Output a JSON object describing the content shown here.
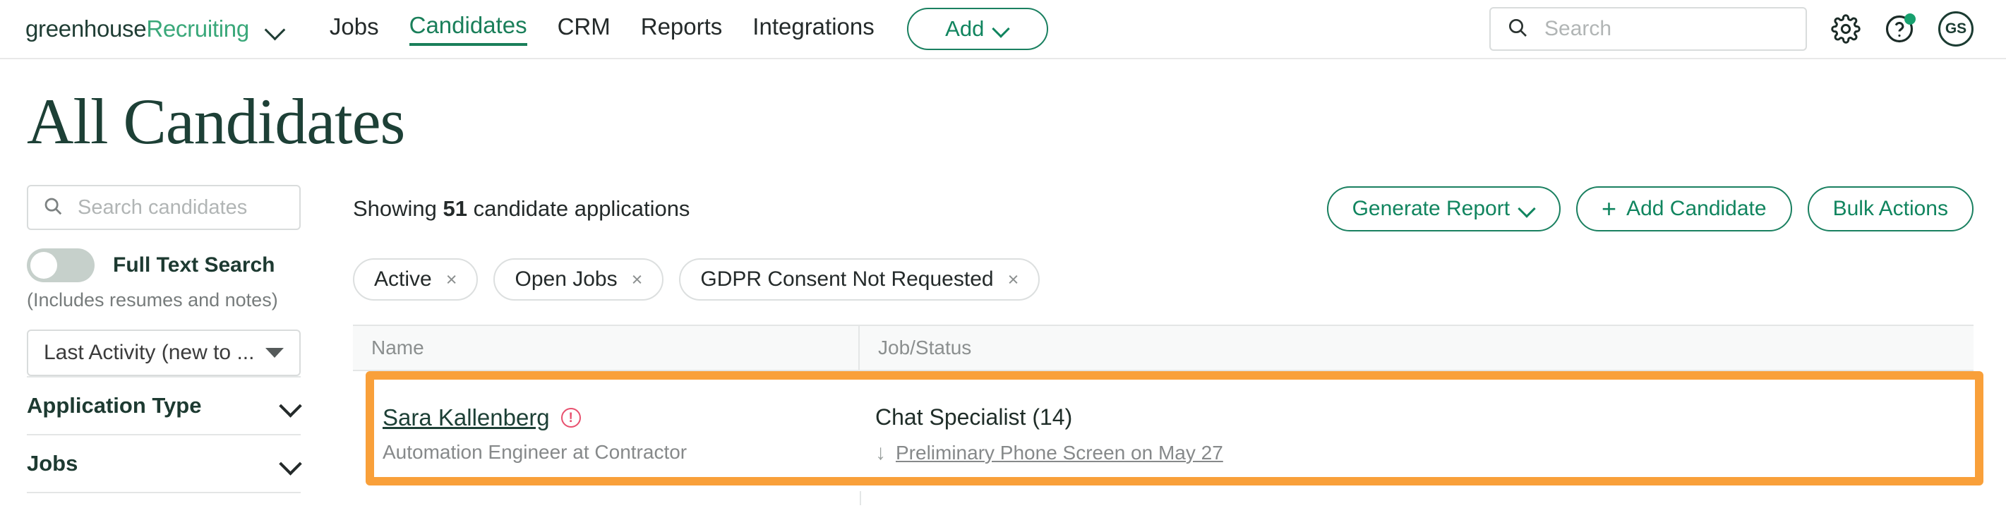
{
  "nav": {
    "brand_primary": "greenhouse",
    "brand_secondary": "Recruiting",
    "links": [
      {
        "label": "Jobs",
        "active": false
      },
      {
        "label": "Candidates",
        "active": true
      },
      {
        "label": "CRM",
        "active": false
      },
      {
        "label": "Reports",
        "active": false
      },
      {
        "label": "Integrations",
        "active": false
      }
    ],
    "add_button": "Add",
    "search_placeholder": "Search",
    "search_value": "",
    "avatar_initials": "GS",
    "icons": {
      "brand_caret": "chevron-down-icon",
      "search": "search-icon",
      "settings": "gear-icon",
      "help": "question-mark-icon",
      "help_badge": "notification-dot"
    }
  },
  "page": {
    "title": "All Candidates"
  },
  "sidebar": {
    "search_placeholder": "Search candidates",
    "search_value": "",
    "full_text_search_label": "Full Text Search",
    "full_text_search_sub": "(Includes resumes and notes)",
    "full_text_search_on": false,
    "sort_selected": "Last Activity (new to ...",
    "filters": [
      {
        "label": "Application Type",
        "expanded": false
      },
      {
        "label": "Jobs",
        "expanded": false
      }
    ]
  },
  "main": {
    "showing_prefix": "Showing",
    "showing_count": "51",
    "showing_suffix": "candidate applications",
    "actions": [
      {
        "label": "Generate Report",
        "has_caret": true,
        "has_plus": false
      },
      {
        "label": "Add Candidate",
        "has_caret": false,
        "has_plus": true
      },
      {
        "label": "Bulk Actions",
        "has_caret": false,
        "has_plus": false
      }
    ],
    "chips": [
      {
        "label": "Active",
        "remove": "×"
      },
      {
        "label": "Open Jobs",
        "remove": "×"
      },
      {
        "label": "GDPR Consent Not Requested",
        "remove": "×"
      }
    ],
    "table": {
      "columns": [
        "Name",
        "Job/Status"
      ],
      "rows": [
        {
          "name": "Sara Kallenberg",
          "name_warning_icon": "alert-circle-icon",
          "subtitle": "Automation Engineer at Contractor",
          "job": "Chat Specialist (14)",
          "status_arrow": "↓",
          "status": "Preliminary Phone Screen on May 27",
          "highlighted": true
        }
      ]
    }
  },
  "colors": {
    "brand_green": "#1a7f5a",
    "brand_dark": "#1d4036",
    "highlight_orange": "#f9a03a",
    "warning_red": "#e8506e"
  }
}
